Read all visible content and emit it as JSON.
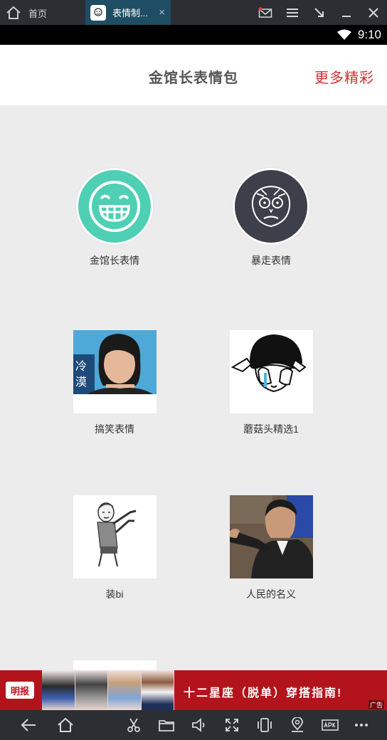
{
  "emulator": {
    "home_label": "首页",
    "tab_label": "表情制...",
    "tab_close": "×"
  },
  "status": {
    "time": "9:10"
  },
  "header": {
    "title": "金馆长表情包",
    "more": "更多精彩"
  },
  "items": [
    {
      "label": "金馆长表情",
      "icon": "grinning-face-icon"
    },
    {
      "label": "暴走表情",
      "icon": "rage-face-icon"
    },
    {
      "label": "搞笑表情",
      "icon": "woman-portrait-thumbnail"
    },
    {
      "label": "蘑菇头精选1",
      "icon": "mushroom-head-thumbnail"
    },
    {
      "label": "装bi",
      "icon": "pointing-man-thumbnail"
    },
    {
      "label": "人民的名义",
      "icon": "politician-thumbnail"
    }
  ],
  "ad": {
    "logo": "明报",
    "text": "十二星座（脱单）穿搭指南!",
    "tag": "广告"
  },
  "colors": {
    "accent": "#d32f2f",
    "teal": "#4fcfb3",
    "dark_circle": "#3d3f4a",
    "ad_bg": "#b3131b"
  }
}
